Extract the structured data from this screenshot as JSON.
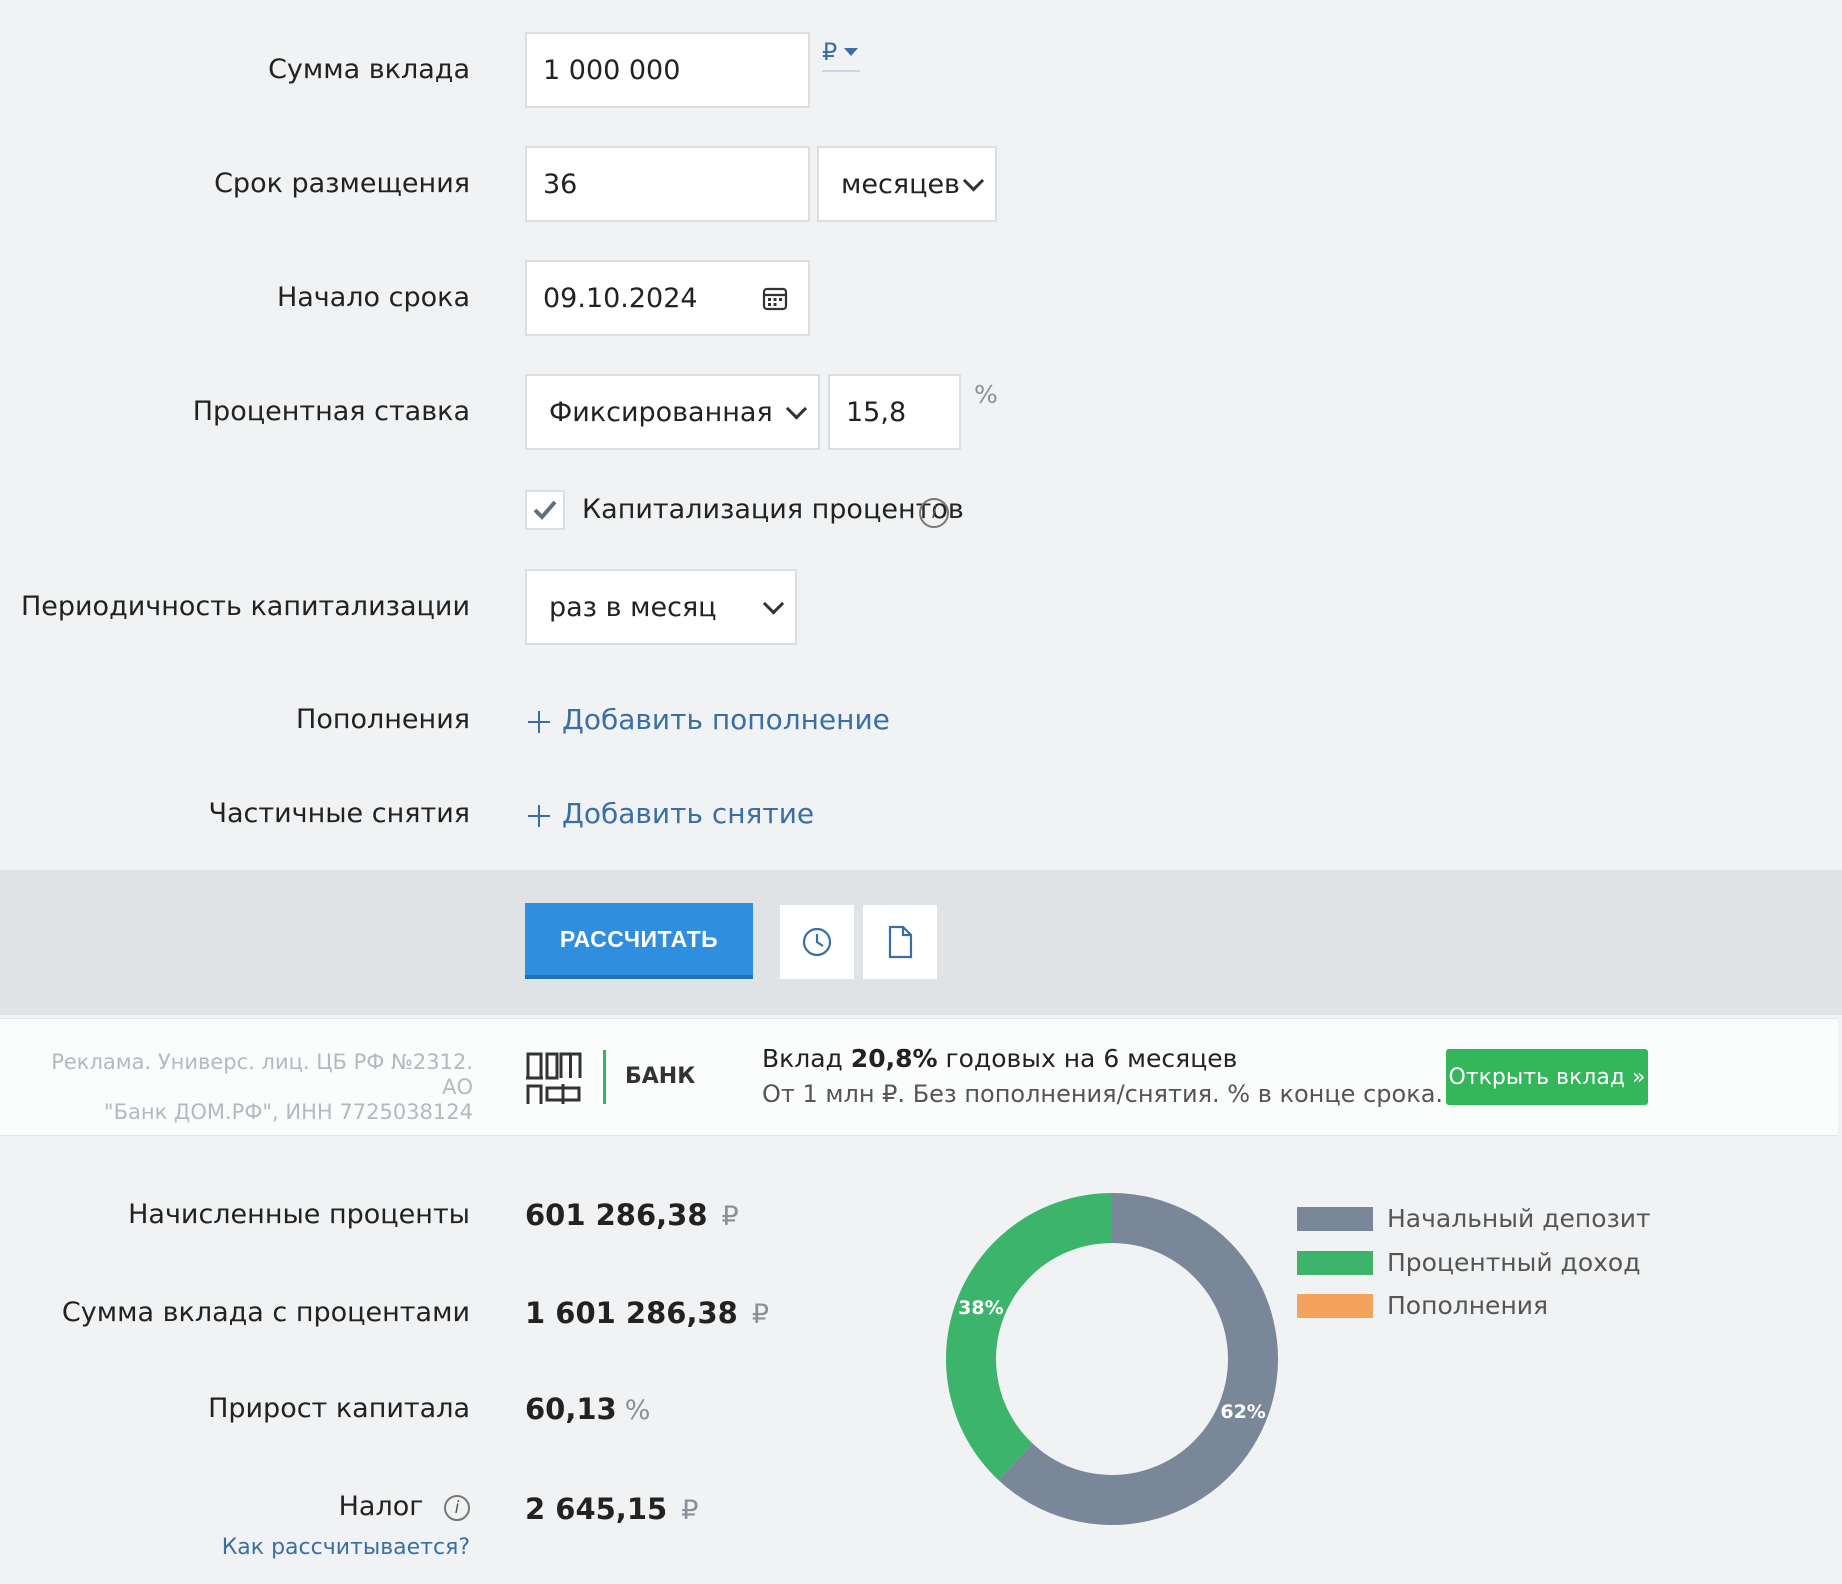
{
  "form": {
    "deposit_amount": {
      "label": "Сумма вклада",
      "value": "1 000 000",
      "currency": "₽"
    },
    "term": {
      "label": "Срок размещения",
      "value": "36",
      "unit": "месяцев"
    },
    "start": {
      "label": "Начало срока",
      "value": "09.10.2024"
    },
    "rate": {
      "label": "Процентная ставка",
      "type": "Фиксированная",
      "value": "15,8",
      "unit": "%"
    },
    "capitalization": {
      "label": "Капитализация процентов",
      "checked": true,
      "info": "i"
    },
    "cap_period": {
      "label": "Периодичность капитализации",
      "value": "раз в месяц"
    },
    "deposits": {
      "label": "Пополнения",
      "link": "Добавить пополнение"
    },
    "withdrawals": {
      "label": "Частичные снятия",
      "link": "Добавить снятие"
    }
  },
  "actions": {
    "calculate": "РАССЧИТАТЬ"
  },
  "ad": {
    "legal_1": "Реклама. Универс. лиц. ЦБ РФ №2312. АО",
    "legal_2": "\"Банк ДОМ.РФ\", ИНН 7725038124",
    "logo_text": "БАНК",
    "title_pre": "Вклад ",
    "title_bold": "20,8%",
    "title_post": " годовых на 6 месяцев",
    "subtitle": "От 1 млн ₽. Без пополнения/снятия. % в конце срока.",
    "button": "Открыть вклад »",
    "color": "#34b65a"
  },
  "results": {
    "interest": {
      "label": "Начисленные проценты",
      "value": "601 286,38",
      "unit": "₽"
    },
    "total": {
      "label": "Сумма вклада с процентами",
      "value": "1 601 286,38",
      "unit": "₽"
    },
    "growth": {
      "label": "Прирост капитала",
      "value": "60,13",
      "unit": "%"
    },
    "tax": {
      "label": "Налог",
      "value": "2 645,15",
      "unit": "₽",
      "help_link": "Как рассчитывается?"
    }
  },
  "chart_data": {
    "type": "pie",
    "categories": [
      "Начальный депозит",
      "Процентный доход",
      "Пополнения"
    ],
    "values": [
      62,
      38,
      0
    ],
    "labels": [
      "62%",
      "38%",
      ""
    ],
    "colors": [
      "#7a8799",
      "#3cb46b",
      "#f5a25d"
    ],
    "legend": "right"
  }
}
